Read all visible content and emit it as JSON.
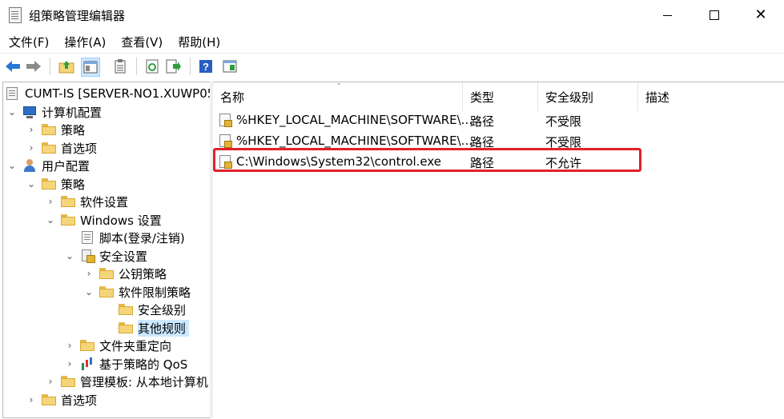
{
  "window": {
    "title": "组策略管理编辑器",
    "close_symbol": "✕"
  },
  "menu": [
    "文件(F)",
    "操作(A)",
    "查看(V)",
    "帮助(H)"
  ],
  "toolbar_icons": [
    "back-arrow-icon",
    "forward-arrow-icon",
    "up-folder-icon",
    "show-hide-tree-icon",
    "properties-icon",
    "refresh-icon",
    "export-list-icon",
    "help-icon",
    "console-view-icon"
  ],
  "tree": {
    "root": "CUMT-IS [SERVER-NO1.XUWP05",
    "computer_config": "计算机配置",
    "cc_policies": "策略",
    "cc_preferences": "首选项",
    "user_config": "用户配置",
    "uc_policies": "策略",
    "software_settings": "软件设置",
    "windows_settings": "Windows 设置",
    "scripts": "脚本(登录/注销)",
    "security_settings": "安全设置",
    "public_key_policies": "公钥策略",
    "software_restriction": "软件限制策略",
    "security_levels": "安全级别",
    "other_rules": "其他规则",
    "folder_redirection": "文件夹重定向",
    "qos": "基于策略的 QoS",
    "admin_templates": "管理模板: 从本地计算机",
    "uc_preferences": "首选项"
  },
  "list": {
    "columns": [
      "名称",
      "类型",
      "安全级别",
      "描述"
    ],
    "sort_indicator": "⌃",
    "rows": [
      {
        "name": "%HKEY_LOCAL_MACHINE\\SOFTWARE\\...",
        "type": "路径",
        "level": "不受限",
        "desc": ""
      },
      {
        "name": "%HKEY_LOCAL_MACHINE\\SOFTWARE\\...",
        "type": "路径",
        "level": "不受限",
        "desc": ""
      },
      {
        "name": "C:\\Windows\\System32\\control.exe",
        "type": "路径",
        "level": "不允许",
        "desc": ""
      }
    ]
  },
  "colors": {
    "highlight": "#e2202c",
    "selection": "#cce8ff",
    "arrow_blue": "#2a78d6"
  }
}
